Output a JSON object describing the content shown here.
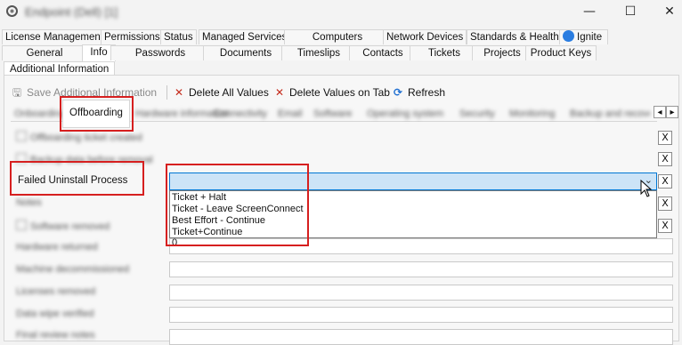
{
  "window": {
    "title": "Endpoint (Dell) [1]",
    "controls": [
      "—",
      "☐",
      "✕"
    ]
  },
  "tabs_row1": [
    "License Management",
    "Permissions",
    "Status",
    "Managed Services",
    "Computers",
    "Network Devices",
    "Standards & Health",
    "Ignite"
  ],
  "tabs_row2": [
    "General",
    "Info",
    "Passwords",
    "Documents",
    "Timeslips",
    "Contacts",
    "Tickets",
    "Projects",
    "Product Keys"
  ],
  "section_label": "Additional Information",
  "toolbar": {
    "save_label": "Save Additional Information",
    "delete_all_label": "Delete All Values",
    "delete_tab_label": "Delete Values on Tab",
    "refresh_label": "Refresh"
  },
  "inner_tabs": {
    "active": "Offboarding",
    "blurred_before": "Onboarding",
    "blurred_after": [
      "Hardware information",
      "Connectivity",
      "Email",
      "Software",
      "Operating system",
      "Security",
      "Monitoring",
      "Backup and recovery"
    ],
    "scroll_left": "◂",
    "scroll_right": "▸"
  },
  "fields": {
    "row1_label": "Offboarding ticket created",
    "row2_label": "Backup data before removal",
    "failed_uninstall_label": "Failed Uninstall Process",
    "row4_label": "Notes",
    "row5_label": "Software removed",
    "row6_label": "Hardware returned",
    "row7_label": "Machine decommissioned",
    "row8_label": "Licenses removed",
    "row9_label": "Data wipe verified",
    "row10_label": "Final review notes",
    "partial_value": "0"
  },
  "dropdown": {
    "selected": "",
    "options": [
      "Ticket + Halt",
      "Ticket - Leave ScreenConnect",
      "Best Effort - Continue",
      "Ticket+Continue"
    ]
  },
  "clear_button_label": "X",
  "colors": {
    "highlight_red": "#d61f1f",
    "dropdown_selected_bg": "#cce4f7",
    "dropdown_border": "#0078d4",
    "delete_icon": "#c42b1c",
    "refresh_icon": "#1f6fd1"
  }
}
